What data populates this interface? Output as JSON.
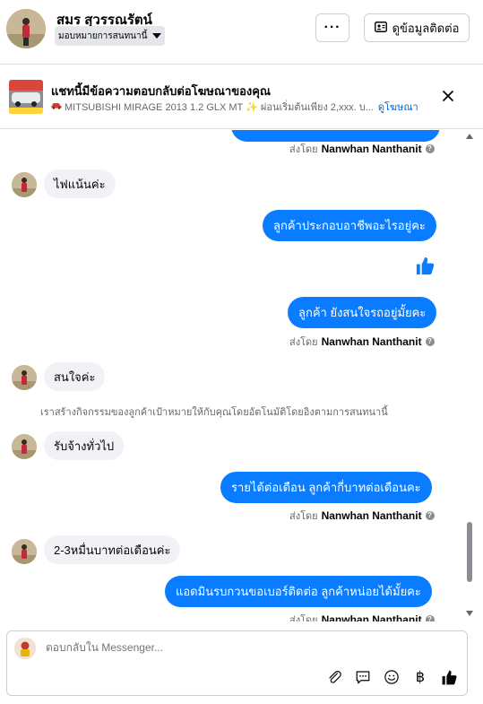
{
  "header": {
    "contact_name": "สมร สุวรรณรัตน์",
    "assign_label": "มอบหมายการสนทนานี้",
    "more_label": "···",
    "info_label": "ดูข้อมูลติดต่อ"
  },
  "ad_banner": {
    "title": "แชทนี้มีข้อความตอบกลับต่อโฆษณาของคุณ",
    "subtitle": "MITSUBISHI MIRAGE 2013 1.2 GLX MT ✨ ผ่อนเริ่มต้นเพียง 2,xxx. บ...",
    "link": "ดูโฆษณา"
  },
  "messages": [
    {
      "type": "sent_by",
      "prefix": "ส่งโดย",
      "sender": "Nanwhan Nanthanit"
    },
    {
      "type": "in",
      "text": "ไฟแน้นค่ะ"
    },
    {
      "type": "out",
      "text": "ลูกค้าประกอบอาชีพอะไรอยู่คะ"
    },
    {
      "type": "out_like"
    },
    {
      "type": "out",
      "text": "ลูกค้า ยังสนใจรถอยู่มั้ยคะ"
    },
    {
      "type": "sent_by",
      "prefix": "ส่งโดย",
      "sender": "Nanwhan Nanthanit"
    },
    {
      "type": "in",
      "text": "สนใจค่ะ"
    },
    {
      "type": "system",
      "text": "เราสร้างกิจกรรมของลูกค้าเป้าหมายให้กับคุณโดยอัตโนมัติโดยอิงตามการสนทนานี้"
    },
    {
      "type": "in",
      "text": "รับจ้างทั่วไป"
    },
    {
      "type": "out",
      "text": "รายได้ต่อเดือน ลูกค้ากี่บาทต่อเดือนคะ"
    },
    {
      "type": "sent_by",
      "prefix": "ส่งโดย",
      "sender": "Nanwhan Nanthanit"
    },
    {
      "type": "in",
      "text": "2-3หมื่นบาทต่อเดือนค่ะ"
    },
    {
      "type": "out",
      "text": "แอดมินรบกวนขอเบอร์ติดต่อ ลูกค้าหน่อยได้มั้ยคะ"
    },
    {
      "type": "sent_by",
      "prefix": "ส่งโดย",
      "sender": "Nanwhan Nanthanit"
    }
  ],
  "composer": {
    "placeholder": "ตอบกลับใน Messenger..."
  },
  "colors": {
    "outgoing_bubble": "#0a7cff",
    "incoming_bubble": "#f0f2f5",
    "link": "#0064d1"
  },
  "icons": {
    "ad_sub_car": "red-car-icon",
    "attach": "paperclip-icon",
    "saved_reply": "chat-bubble-icon",
    "emoji": "smiley-icon",
    "payment": "baht-icon",
    "like": "thumbs-up-icon"
  }
}
